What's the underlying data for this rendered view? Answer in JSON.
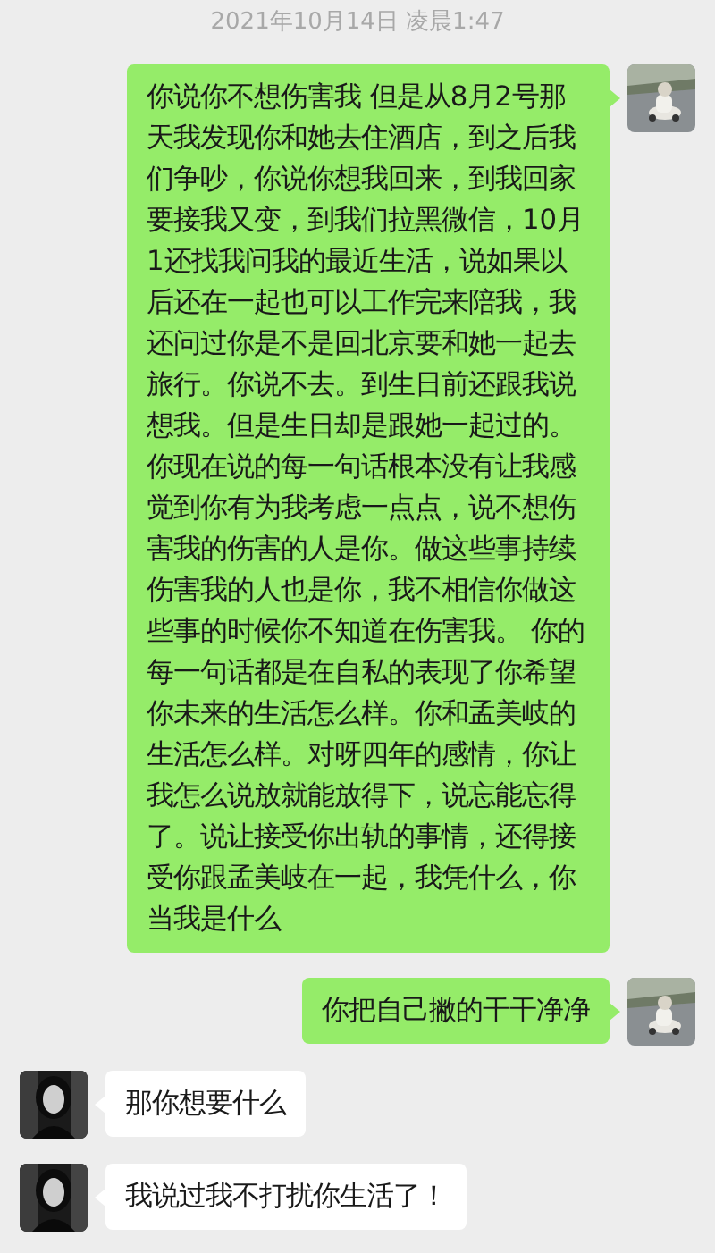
{
  "timestamp": "2021年10月14日 凌晨1:47",
  "messages": [
    {
      "kind": "self",
      "text": "你说你不想伤害我 但是从8月2号那天我发现你和她去住酒店，到之后我们争吵，你说你想我回来，到我回家要接我又变，到我们拉黑微信，10月1还找我问我的最近生活，说如果以后还在一起也可以工作完来陪我，我还问过你是不是回北京要和她一起去旅行。你说不去。到生日前还跟我说想我。但是生日却是跟她一起过的。你现在说的每一句话根本没有让我感觉到你有为我考虑一点点，说不想伤害我的伤害的人是你。做这些事持续伤害我的人也是你，我不相信你做这些事的时候你不知道在伤害我。 你的每一句话都是在自私的表现了你希望你未来的生活怎么样。你和孟美岐的生活怎么样。对呀四年的感情，你让我怎么说放就能放得下，说忘能忘得了。说让接受你出轨的事情，还得接受你跟孟美岐在一起，我凭什么，你当我是什么"
    },
    {
      "kind": "self",
      "text": "你把自己撇的干干净净"
    },
    {
      "kind": "other",
      "text": "那你想要什么"
    },
    {
      "kind": "other",
      "text": "我说过我不打扰你生活了！"
    }
  ]
}
